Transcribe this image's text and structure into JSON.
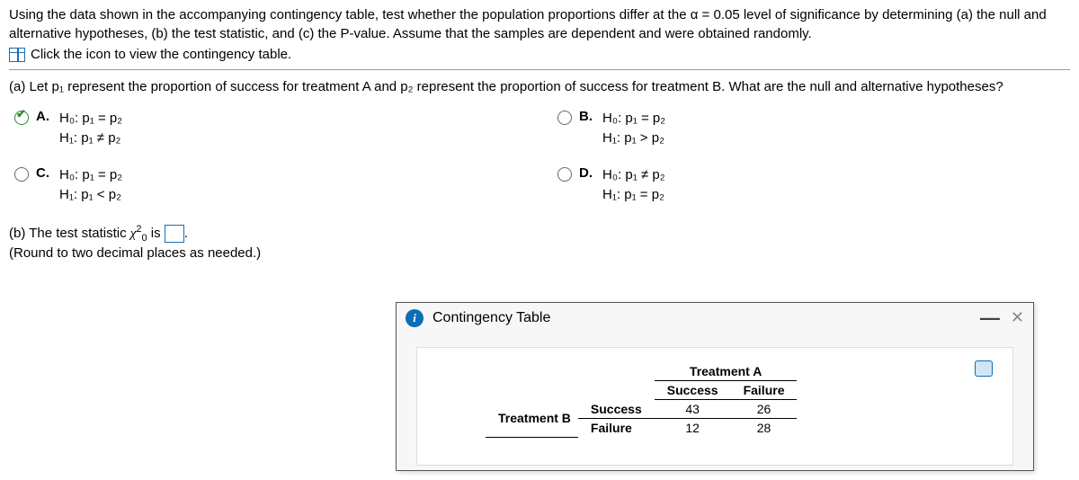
{
  "problem": {
    "line1": "Using the data shown in the accompanying contingency table, test whether the population proportions differ at the α = 0.05 level of significance by determining (a) the null and alternative hypotheses, (b) the test statistic, and (c) the P-value. Assume that the samples are dependent and were obtained randomly.",
    "icon_line": "Click the icon to view the contingency table."
  },
  "partA": {
    "intro": "(a) Let p₁ represent the proportion of success for treatment A and p₂ represent the proportion of success for treatment B. What are the null and alternative hypotheses?",
    "options": {
      "A": {
        "label": "A.",
        "h0": "H₀: p₁ = p₂",
        "h1": "H₁: p₁ ≠ p₂",
        "selected": true
      },
      "B": {
        "label": "B.",
        "h0": "H₀: p₁ = p₂",
        "h1": "H₁: p₁ > p₂",
        "selected": false
      },
      "C": {
        "label": "C.",
        "h0": "H₀: p₁ = p₂",
        "h1": "H₁: p₁ < p₂",
        "selected": false
      },
      "D": {
        "label": "D.",
        "h0": "H₀: p₁ ≠ p₂",
        "h1": "H₁: p₁ = p₂",
        "selected": false
      }
    }
  },
  "partB": {
    "prefix": "(b) The test statistic ",
    "chi_prefix": "χ",
    "chi_sup": "2",
    "chi_sub": "0",
    "is_text": " is ",
    "period": ".",
    "round_note": "(Round to two decimal places as needed.)"
  },
  "popup": {
    "title": "Contingency Table",
    "info_glyph": "i",
    "minimize": "—",
    "close": "✕",
    "headers": {
      "top": "Treatment A",
      "col1": "Success",
      "col2": "Failure",
      "side": "Treatment B",
      "row1": "Success",
      "row2": "Failure"
    },
    "cells": {
      "r1c1": "43",
      "r1c2": "26",
      "r2c1": "12",
      "r2c2": "28"
    }
  },
  "chart_data": {
    "type": "table",
    "title": "Contingency Table",
    "row_label": "Treatment B",
    "col_label": "Treatment A",
    "columns": [
      "Success",
      "Failure"
    ],
    "rows": [
      "Success",
      "Failure"
    ],
    "values": [
      [
        43,
        26
      ],
      [
        12,
        28
      ]
    ]
  }
}
